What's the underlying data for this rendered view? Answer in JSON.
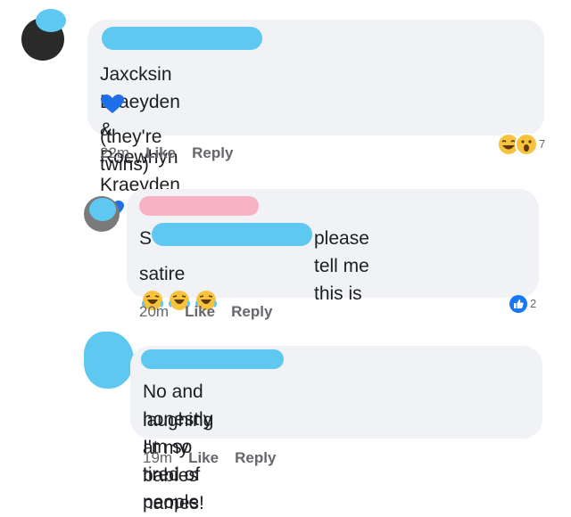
{
  "comments": [
    {
      "line1": "Jaxcksin Braeyden & Roewhyn Kraeyden",
      "line2": "(they're twins)",
      "time": "22m",
      "like": "Like",
      "reply": "Reply",
      "reactions": {
        "count": "7",
        "icons": [
          "laugh-emoji-icon",
          "wow-emoji-icon"
        ]
      }
    },
    {
      "prefix": "S",
      "line1": "please tell me this is",
      "line2": "satire",
      "time": "20m",
      "like": "Like",
      "reply": "Reply",
      "reactions": {
        "count": "2",
        "icons": [
          "like-thumb-icon"
        ]
      }
    },
    {
      "line1": "No and honestly I'm so tired of people",
      "line2": "laughing at my babies names!",
      "time": "19m",
      "like": "Like",
      "reply": "Reply"
    }
  ],
  "colors": {
    "bubble": "#f0f2f5",
    "redaction_blue": "#5ec8f0",
    "redaction_pink": "#f7b3c3",
    "meta_text": "#65676b",
    "heart_blue": "#1e6fe8",
    "like_blue": "#1877f2"
  }
}
